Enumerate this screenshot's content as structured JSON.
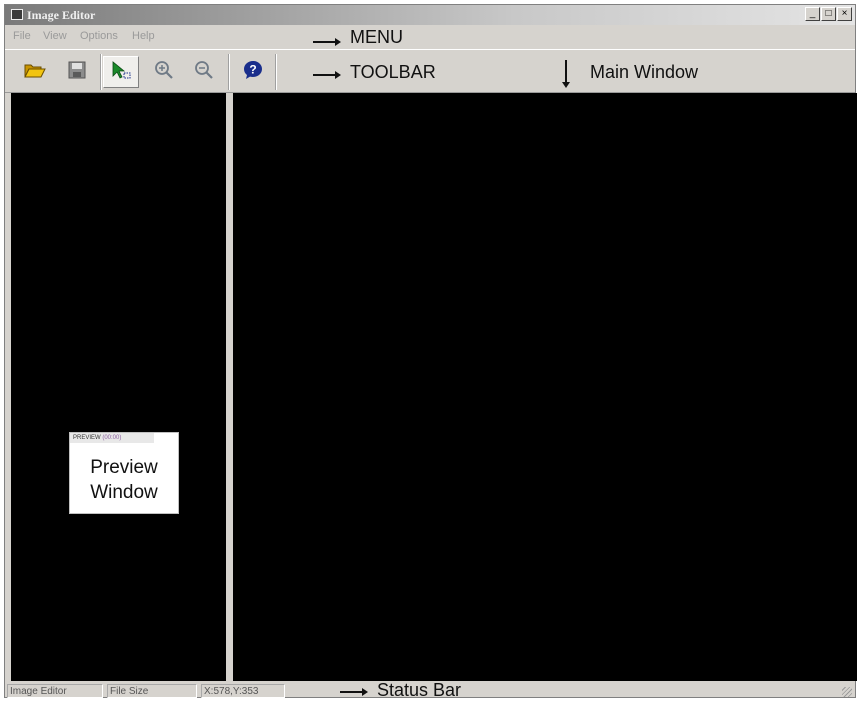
{
  "window": {
    "title": "Image Editor",
    "controls": {
      "minimize": "_",
      "maximize": "□",
      "close": "×"
    }
  },
  "menu": {
    "items": [
      {
        "label": "File"
      },
      {
        "label": "View"
      },
      {
        "label": "Options"
      },
      {
        "label": "Help"
      }
    ]
  },
  "toolbar": {
    "buttons": [
      {
        "name": "open-folder-icon",
        "pressed": false
      },
      {
        "name": "save-disk-icon",
        "pressed": false
      },
      {
        "name": "select-pointer-icon",
        "pressed": true
      },
      {
        "name": "zoom-in-icon",
        "pressed": false
      },
      {
        "name": "zoom-out-icon",
        "pressed": false
      },
      {
        "name": "help-icon",
        "pressed": false
      }
    ]
  },
  "preview": {
    "header": "PREVIEW",
    "header_sub": "(00:00)",
    "label_line1": "Preview",
    "label_line2": "Window"
  },
  "statusbar": {
    "app": "Image Editor",
    "filesize": "File Size",
    "coords": "X:578,Y:353"
  },
  "annotations": {
    "menu": "MENU",
    "toolbar": "TOOLBAR",
    "main_window": "Main Window",
    "status_bar": "Status Bar"
  },
  "colors": {
    "chrome": "#d6d3ce",
    "canvas": "#000000",
    "help_icon": "#1a2e8c",
    "open_icon": "#e8b400"
  }
}
